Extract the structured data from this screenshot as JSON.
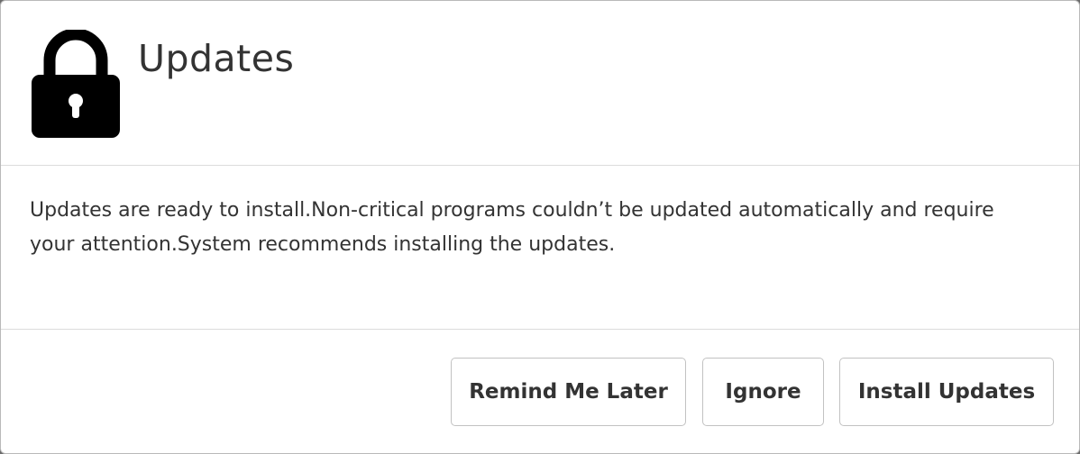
{
  "dialog": {
    "title": "Updates",
    "icon": "lock-icon",
    "message": "Updates are ready to install.Non-critical programs couldn’t be updated automatically and require your attention.System recommends installing the updates.",
    "buttons": {
      "remind_label": "Remind Me Later",
      "ignore_label": "Ignore",
      "install_label": "Install Updates"
    }
  },
  "colors": {
    "text": "#333333",
    "border": "#c2c2c2",
    "divider": "#dcdcdc",
    "icon": "#000000"
  }
}
